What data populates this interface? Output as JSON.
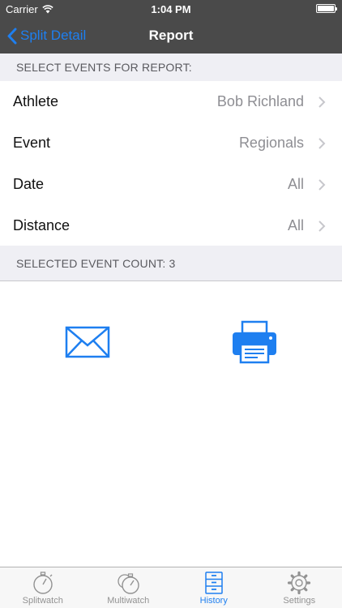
{
  "status_bar": {
    "carrier": "Carrier",
    "time": "1:04 PM"
  },
  "nav": {
    "back_label": "Split Detail",
    "title": "Report"
  },
  "sections": {
    "select_header": "SELECT EVENTS FOR REPORT:",
    "count_header": "SELECTED EVENT COUNT:  3"
  },
  "rows": [
    {
      "label": "Athlete",
      "value": "Bob Richland"
    },
    {
      "label": "Event",
      "value": "Regionals"
    },
    {
      "label": "Date",
      "value": "All"
    },
    {
      "label": "Distance",
      "value": "All"
    }
  ],
  "actions": {
    "email_icon": "envelope-icon",
    "print_icon": "printer-icon"
  },
  "tabs": [
    {
      "label": "Splitwatch",
      "icon": "stopwatch-icon",
      "active": false
    },
    {
      "label": "Multiwatch",
      "icon": "multi-stopwatch-icon",
      "active": false
    },
    {
      "label": "History",
      "icon": "file-cabinet-icon",
      "active": true
    },
    {
      "label": "Settings",
      "icon": "gear-icon",
      "active": false
    }
  ],
  "colors": {
    "accent": "#1e7ff0",
    "nav_bg": "#4a4a4a",
    "section_bg": "#efeff4",
    "inactive_tab": "#929292"
  }
}
